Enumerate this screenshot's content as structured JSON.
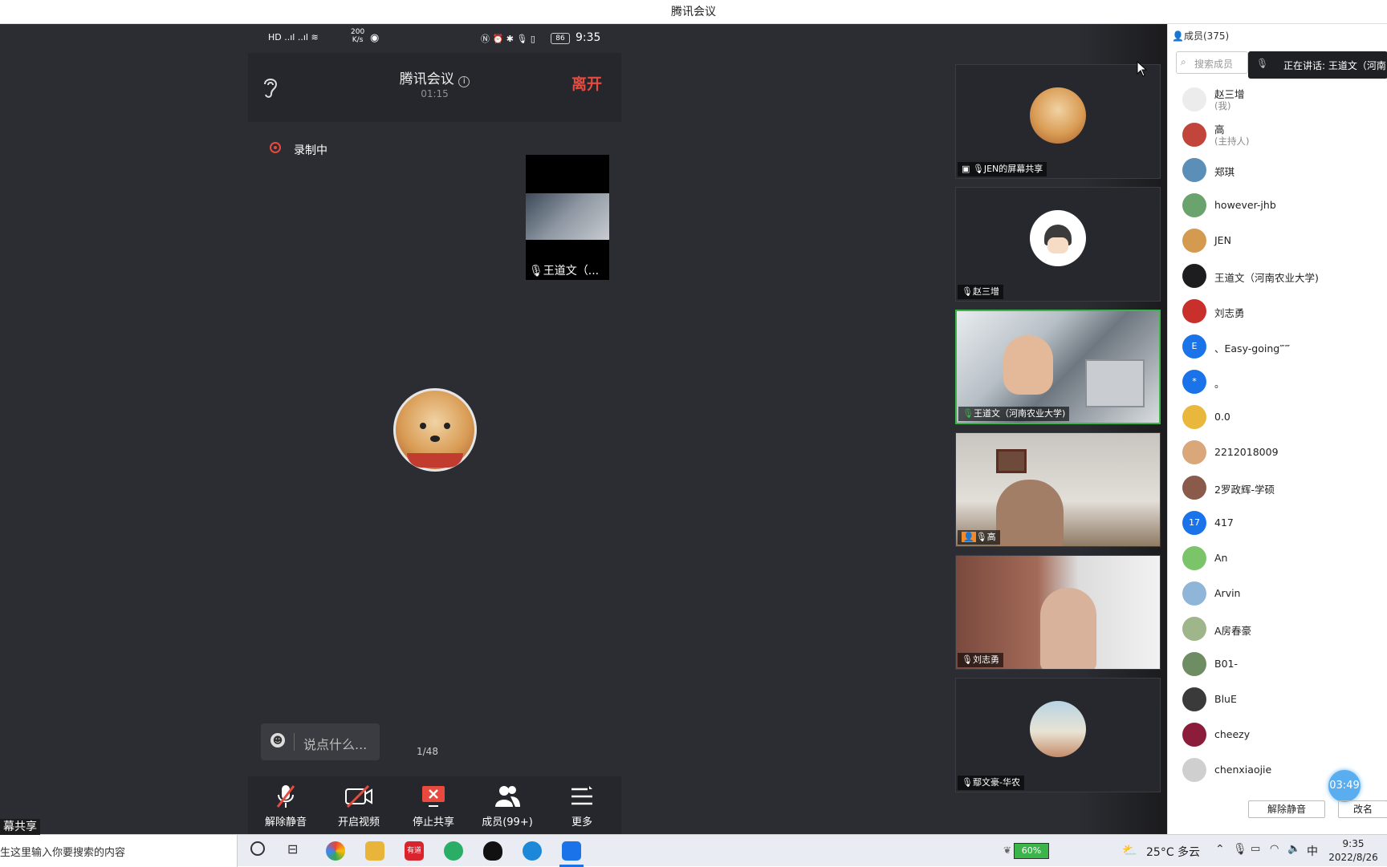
{
  "window": {
    "title": "腾讯会议"
  },
  "phone": {
    "status": {
      "speed_value": "200",
      "speed_unit": "K/s",
      "battery": "86",
      "time": "9:35"
    },
    "header": {
      "title": "腾讯会议",
      "timer": "01:15",
      "leave": "离开"
    },
    "recording": "录制中",
    "pip_name": "王道文（...",
    "chat_placeholder": "说点什么...",
    "page": "1/48",
    "controls": [
      {
        "label": "解除静音"
      },
      {
        "label": "开启视频"
      },
      {
        "label": "停止共享"
      },
      {
        "label": "成员(99+)"
      },
      {
        "label": "更多"
      }
    ]
  },
  "gallery": {
    "tiles": [
      {
        "name": "JEN的屏幕共享"
      },
      {
        "name": "赵三增"
      },
      {
        "name": "王道文（河南农业大学)"
      },
      {
        "name": "高"
      },
      {
        "name": "刘志勇"
      },
      {
        "name": "鄢文豪-华农"
      }
    ]
  },
  "panel": {
    "title": "成员(375)",
    "search_placeholder": "搜索成员",
    "speaking": "正在讲话: 王道文（河南",
    "members": [
      {
        "name": "赵三增",
        "sub": "(我)",
        "avatar": "",
        "color": "#ececec"
      },
      {
        "name": "高",
        "sub": "(主持人)",
        "avatar": "",
        "color": "#c2453c"
      },
      {
        "name": "郑琪",
        "sub": "",
        "avatar": "",
        "color": "#5b8fb8"
      },
      {
        "name": "however-jhb",
        "sub": "",
        "avatar": "",
        "color": "#6aa36d"
      },
      {
        "name": "JEN",
        "sub": "",
        "avatar": "",
        "color": "#d49a4f"
      },
      {
        "name": "王道文（河南农业大学)",
        "sub": "",
        "avatar": "",
        "color": "#1d1d1f"
      },
      {
        "name": "刘志勇",
        "sub": "",
        "avatar": "",
        "color": "#c9302c"
      },
      {
        "name": "、Easy-going‴‴",
        "sub": "",
        "avatar": "E",
        "color": "#1a73e8"
      },
      {
        "name": "。",
        "sub": "",
        "avatar": "*",
        "color": "#1a73e8"
      },
      {
        "name": "0.0",
        "sub": "",
        "avatar": "",
        "color": "#e8b73b"
      },
      {
        "name": "2212018009",
        "sub": "",
        "avatar": "",
        "color": "#d9a77a"
      },
      {
        "name": "2罗政辉-学硕",
        "sub": "",
        "avatar": "",
        "color": "#8a5a4a"
      },
      {
        "name": "417",
        "sub": "",
        "avatar": "17",
        "color": "#1a73e8"
      },
      {
        "name": "An",
        "sub": "",
        "avatar": "",
        "color": "#7bc46a"
      },
      {
        "name": "Arvin",
        "sub": "",
        "avatar": "",
        "color": "#8fb6d8"
      },
      {
        "name": "A房春豪",
        "sub": "",
        "avatar": "",
        "color": "#9fb58a"
      },
      {
        "name": "B01-",
        "sub": "",
        "avatar": "",
        "color": "#6f8d62"
      },
      {
        "name": "BluE",
        "sub": "",
        "avatar": "",
        "color": "#3a3a3a"
      },
      {
        "name": "cheezy",
        "sub": "",
        "avatar": "",
        "color": "#8b1c3a"
      },
      {
        "name": "chenxiaojie",
        "sub": "",
        "avatar": "",
        "color": "#cfcfcf"
      }
    ],
    "unmute_btn": "解除静音",
    "rename_btn": "改名",
    "float_timer": "03:49"
  },
  "taskbar": {
    "left_label": "幕共享",
    "search_placeholder": "生这里输入你要搜索的内容",
    "youdao": "有道",
    "battery": "60%",
    "weather": "25°C 多云",
    "ime": "中",
    "time": "9:35",
    "date": "2022/8/26"
  },
  "colors": {
    "leave_red": "#e84a3d",
    "recording_red": "#e84a3d",
    "active_green": "#3bb54a",
    "brand_blue": "#1a73e8"
  }
}
